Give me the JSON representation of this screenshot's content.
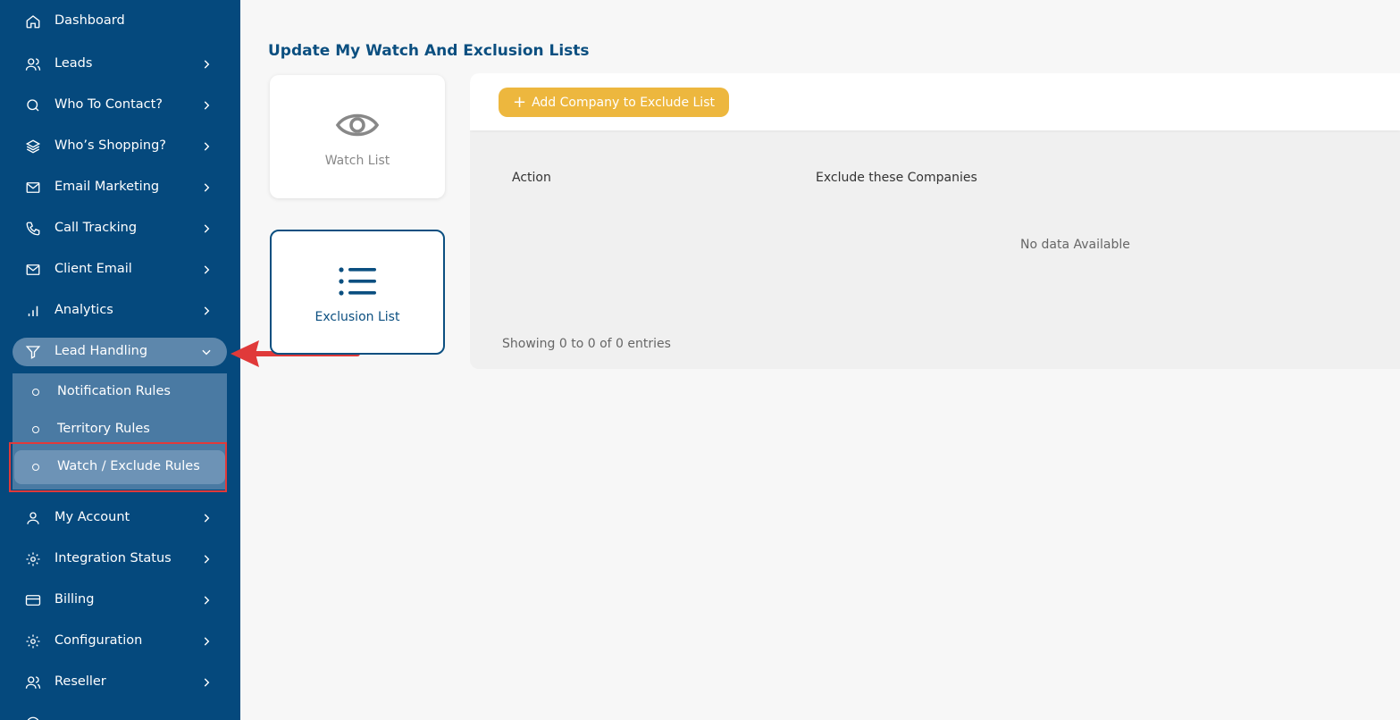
{
  "sidebar": {
    "items": [
      {
        "label": "Dashboard",
        "icon": "home-icon"
      },
      {
        "label": "Leads",
        "icon": "users-icon"
      },
      {
        "label": "Who To Contact?",
        "icon": "search-icon"
      },
      {
        "label": "Who’s Shopping?",
        "icon": "layers-icon"
      },
      {
        "label": "Email Marketing",
        "icon": "mail-icon"
      },
      {
        "label": "Call Tracking",
        "icon": "phone-icon"
      },
      {
        "label": "Client Email",
        "icon": "mail-icon"
      },
      {
        "label": "Analytics",
        "icon": "bar-chart-icon"
      },
      {
        "label": "Lead Handling",
        "icon": "filter-icon"
      },
      {
        "label": "My Account",
        "icon": "user-icon"
      },
      {
        "label": "Integration Status",
        "icon": "gear-icon"
      },
      {
        "label": "Billing",
        "icon": "credit-card-icon"
      },
      {
        "label": "Configuration",
        "icon": "gear-icon"
      },
      {
        "label": "Reseller",
        "icon": "users-icon"
      }
    ],
    "submenu": [
      {
        "label": "Notification Rules"
      },
      {
        "label": "Territory Rules"
      },
      {
        "label": "Watch / Exclude Rules"
      }
    ]
  },
  "main": {
    "title": "Update My Watch And Exclusion Lists",
    "cards": {
      "watch_label": "Watch List",
      "exclusion_label": "Exclusion List"
    },
    "add_button_label": "Add Company to Exclude List",
    "table": {
      "columns": [
        "Action",
        "Exclude these Companies"
      ],
      "empty_text": "No data Available",
      "footer": "Showing 0 to 0 of 0 entries"
    }
  },
  "colors": {
    "sidebar_bg": "#05497d",
    "accent": "#edb73e",
    "title": "#0b4f80",
    "annotation": "#e03a3a"
  }
}
